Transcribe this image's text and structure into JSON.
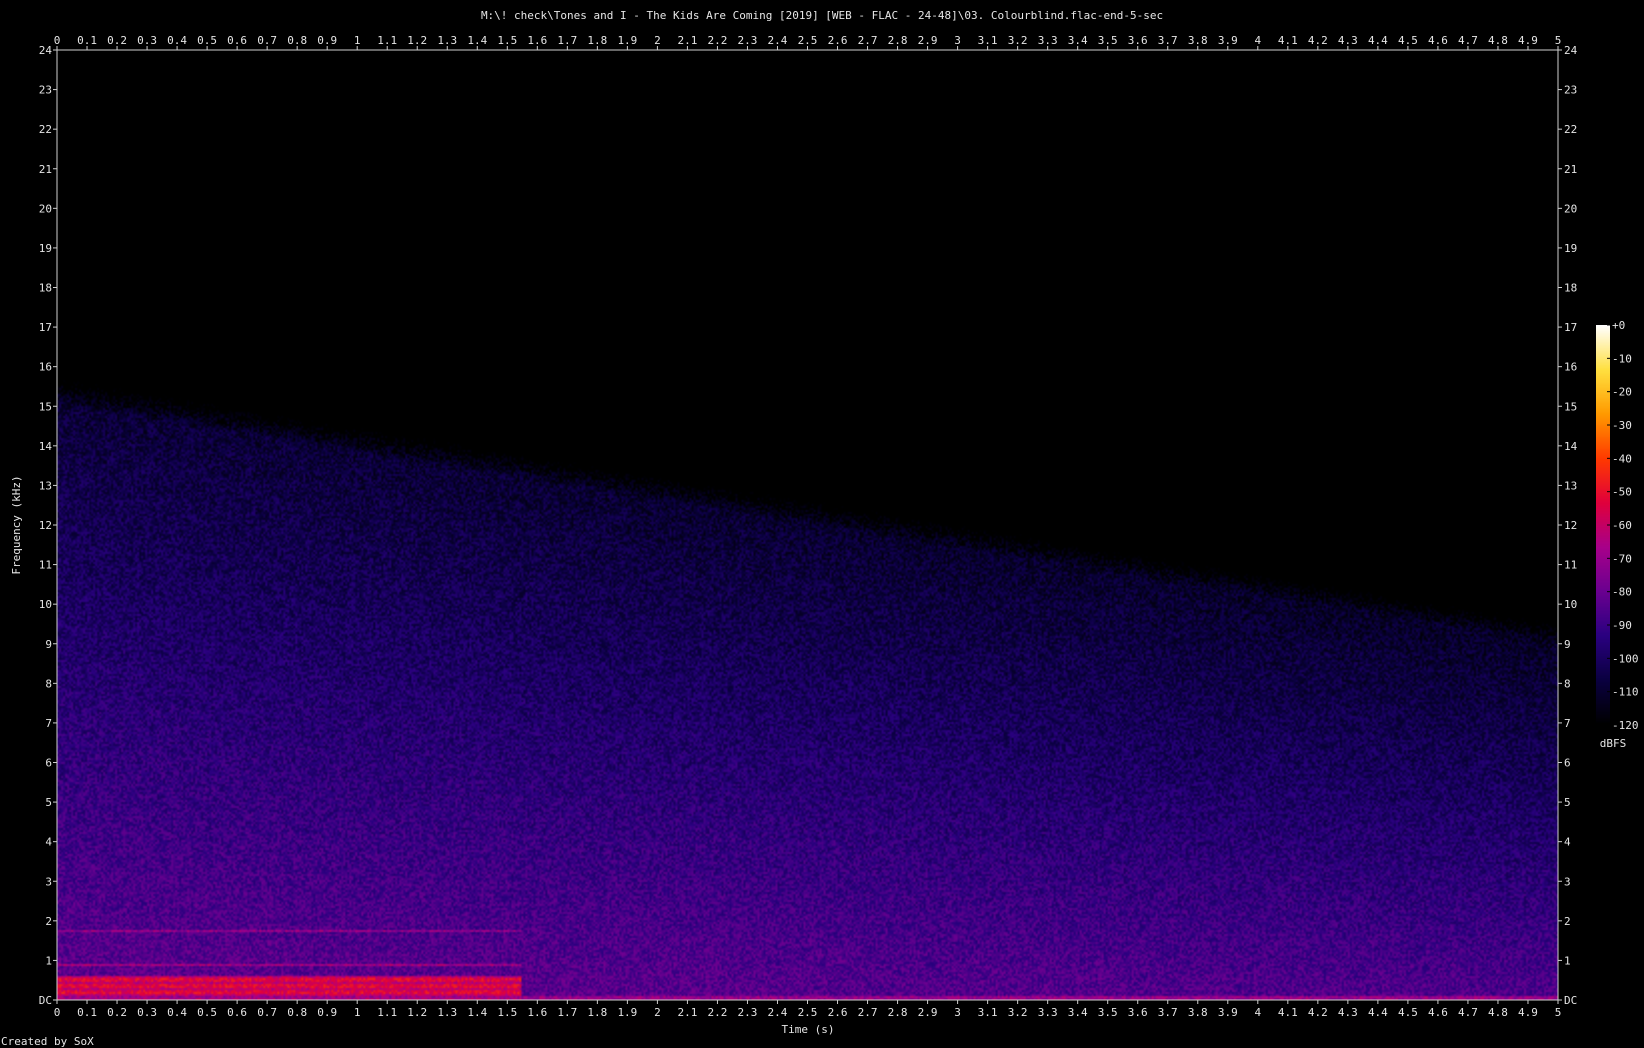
{
  "chart_data": {
    "type": "heatmap",
    "title": "M:\\! check\\Tones and I - The Kids Are Coming [2019] [WEB - FLAC - 24-48]\\03. Colourblind.flac-end-5-sec",
    "xlabel": "Time (s)",
    "ylabel": "Frequency (kHz)",
    "xlim": [
      0,
      5
    ],
    "ylim": [
      0,
      24
    ],
    "x_ticks": [
      "0",
      "0.1",
      "0.2",
      "0.3",
      "0.4",
      "0.5",
      "0.6",
      "0.7",
      "0.8",
      "0.9",
      "1",
      "1.1",
      "1.2",
      "1.3",
      "1.4",
      "1.5",
      "1.6",
      "1.7",
      "1.8",
      "1.9",
      "2",
      "2.1",
      "2.2",
      "2.3",
      "2.4",
      "2.5",
      "2.6",
      "2.7",
      "2.8",
      "2.9",
      "3",
      "3.1",
      "3.2",
      "3.3",
      "3.4",
      "3.5",
      "3.6",
      "3.7",
      "3.8",
      "3.9",
      "4",
      "4.1",
      "4.2",
      "4.3",
      "4.4",
      "4.5",
      "4.6",
      "4.7",
      "4.8",
      "4.9",
      "5"
    ],
    "y_ticks": [
      "DC",
      "1",
      "2",
      "3",
      "4",
      "5",
      "6",
      "7",
      "8",
      "9",
      "10",
      "11",
      "12",
      "13",
      "14",
      "15",
      "16",
      "17",
      "18",
      "19",
      "20",
      "21",
      "22",
      "23",
      "24"
    ],
    "colorbar": {
      "label": "dBFS",
      "ticks": [
        "+0",
        "-10",
        "-20",
        "-30",
        "-40",
        "-50",
        "-60",
        "-70",
        "-80",
        "-90",
        "-100",
        "-110",
        "-120"
      ],
      "range": [
        -120,
        0
      ],
      "colors": [
        "#000000",
        "#0a0040",
        "#2a0080",
        "#6a0090",
        "#a8008a",
        "#e0003c",
        "#ff3a00",
        "#ff9a00",
        "#ffe040",
        "#ffffff"
      ]
    },
    "energy_profile": {
      "note_band_khz": [
        0.1,
        0.6
      ],
      "note_end_s": 1.55,
      "noise_ceiling_khz_start": 15,
      "noise_ceiling_khz_end": 9
    },
    "footer": "Created by SoX"
  }
}
